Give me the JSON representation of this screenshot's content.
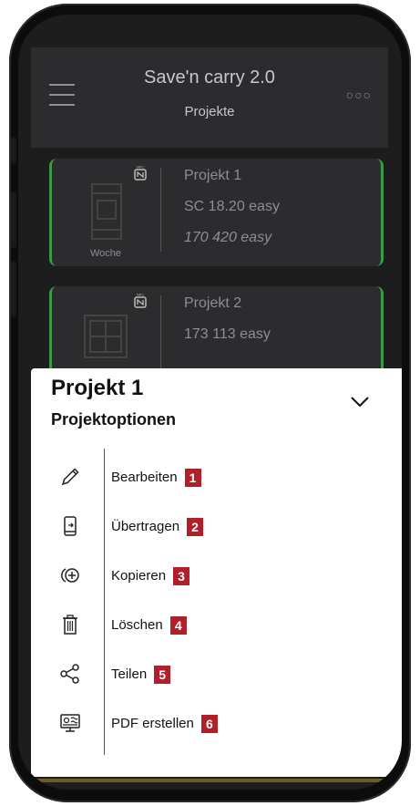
{
  "app": {
    "title": "Save'n carry 2.0",
    "subtitle": "Projekte",
    "menu_icon": "hamburger-menu-icon",
    "more_icon": "more-dots-icon",
    "more_text": "○○○"
  },
  "projects": [
    {
      "name": "Projekt 1",
      "device": "SC 18.20 easy",
      "model": "170 420 easy",
      "thumb_label": "Woche",
      "icon": "nfc-icon",
      "accent": "#3a9a4a"
    },
    {
      "name": "Projekt 2",
      "device": "173 113 easy",
      "icon": "nfc-icon",
      "accent": "#3a9a4a"
    }
  ],
  "sheet": {
    "title": "Projekt 1",
    "subtitle": "Projektoptionen",
    "collapse_icon": "chevron-down-icon",
    "items": [
      {
        "label": "Bearbeiten",
        "badge": "1",
        "icon": "pencil-icon"
      },
      {
        "label": "Übertragen",
        "badge": "2",
        "icon": "phone-transfer-icon"
      },
      {
        "label": "Kopieren",
        "badge": "3",
        "icon": "copy-add-icon"
      },
      {
        "label": "Löschen",
        "badge": "4",
        "icon": "trash-icon"
      },
      {
        "label": "Teilen",
        "badge": "5",
        "icon": "share-icon"
      },
      {
        "label": "PDF erstellen",
        "badge": "6",
        "icon": "pdf-monitor-icon"
      }
    ]
  },
  "colors": {
    "badge": "#b11f2a",
    "card_border": "#3a9a4a",
    "header_bg": "#2c2c2e"
  }
}
